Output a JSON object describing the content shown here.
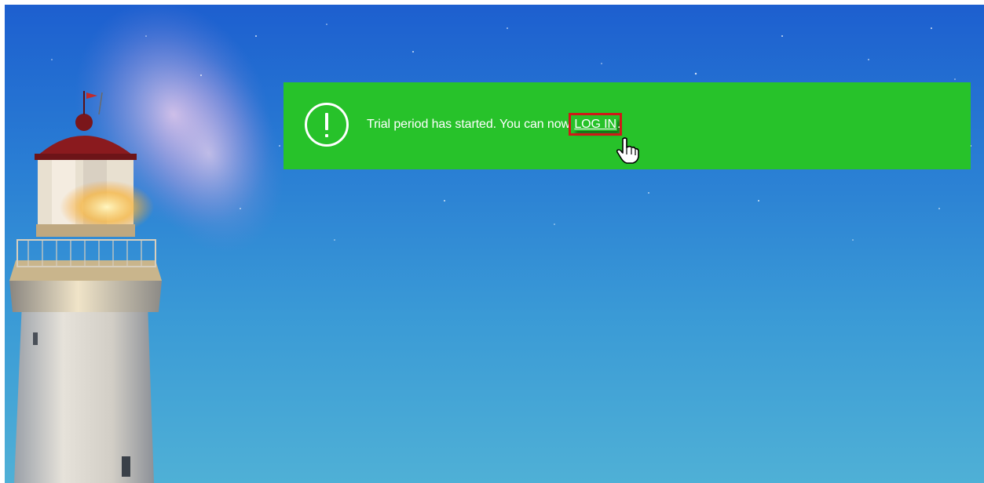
{
  "banner": {
    "message": "Trial period has started. You can now ",
    "link_text": "LOG IN",
    "suffix": ".",
    "icon": "exclamation-circle-icon",
    "color": "#27c22a"
  },
  "highlight_color": "#d01818",
  "cursor": "hand-pointer-icon"
}
